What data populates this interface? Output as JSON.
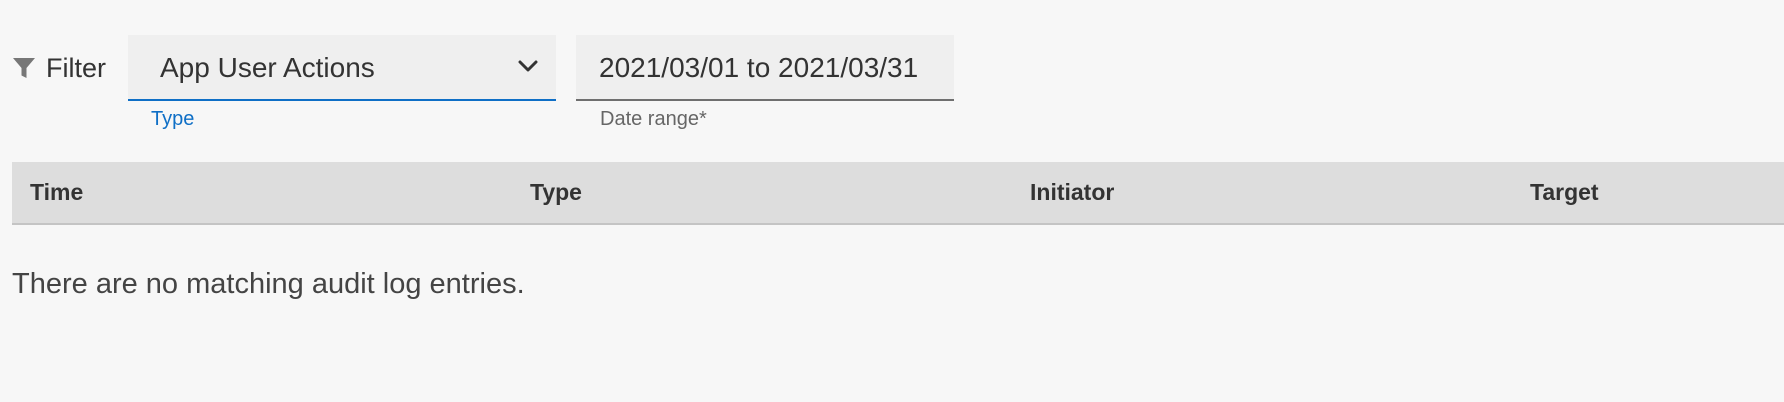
{
  "filter": {
    "label": "Filter",
    "icon": "funnel-icon",
    "type_select": {
      "value": "App User Actions",
      "caption": "Type",
      "icon": "chevron-down-icon"
    },
    "date_range": {
      "value": "2021/03/01 to 2021/03/31",
      "caption": "Date range*"
    }
  },
  "table": {
    "columns": [
      "Time",
      "Type",
      "Initiator",
      "Target"
    ],
    "empty_message": "There are no matching audit log entries."
  },
  "colors": {
    "background": "#f7f7f7",
    "field_background": "#efefef",
    "accent": "#0f6fc6",
    "header_background": "#dddddd"
  }
}
